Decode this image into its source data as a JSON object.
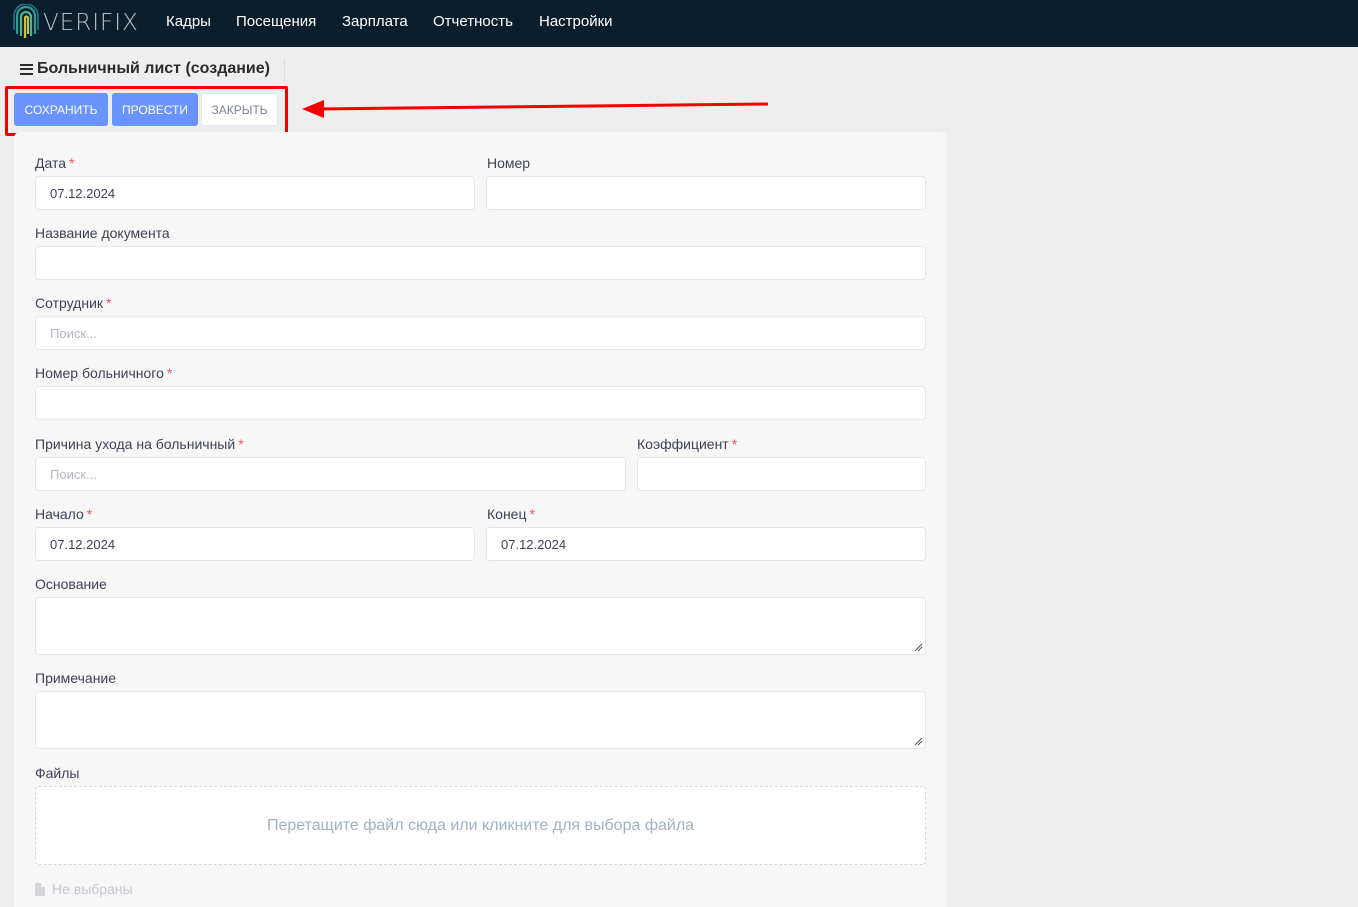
{
  "app": {
    "logo_text": "VERIFIX"
  },
  "nav": {
    "items": [
      "Кадры",
      "Посещения",
      "Зарплата",
      "Отчетность",
      "Настройки"
    ]
  },
  "page": {
    "title": "Больничный лист (создание)"
  },
  "toolbar": {
    "save_label": "Сохранить",
    "post_label": "Провести",
    "close_label": "Закрыть"
  },
  "form": {
    "date": {
      "label": "Дата",
      "value": "07.12.2024"
    },
    "number": {
      "label": "Номер",
      "value": ""
    },
    "doc_name": {
      "label": "Название документа",
      "value": ""
    },
    "employee": {
      "label": "Сотрудник",
      "placeholder": "Поиск..."
    },
    "sick_number": {
      "label": "Номер больничного",
      "value": ""
    },
    "reason": {
      "label": "Причина ухода на больничный",
      "placeholder": "Поиск..."
    },
    "coefficient": {
      "label": "Коэффициент",
      "value": ""
    },
    "start": {
      "label": "Начало",
      "value": "07.12.2024"
    },
    "end": {
      "label": "Конец",
      "value": "07.12.2024"
    },
    "basis": {
      "label": "Основание"
    },
    "note": {
      "label": "Примечание"
    },
    "files": {
      "label": "Файлы",
      "dropzone_text": "Перетащите файл сюда или кликните для выбора файла",
      "empty_text": "Не выбраны"
    }
  },
  "colors": {
    "navbar": "#0b1e2d",
    "primary": "#6993ff",
    "required": "#f64e60",
    "annotation": "#f40000"
  }
}
